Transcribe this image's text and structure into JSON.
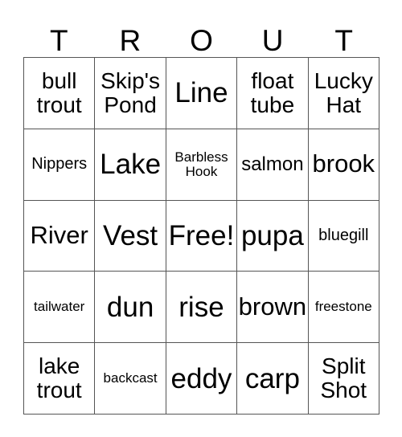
{
  "card": {
    "title_letters": [
      "T",
      "R",
      "O",
      "U",
      "T"
    ],
    "columns": 5,
    "rows": 5,
    "free_space_label": "Free!",
    "free_space_position": {
      "row": 3,
      "column": 3
    },
    "border_color": "#555555",
    "text_color": "#000000",
    "background_color": "#ffffff",
    "grid": [
      [
        {
          "text": "bull\ntrout",
          "size": "lg"
        },
        {
          "text": "Skip's\nPond",
          "size": "lg"
        },
        {
          "text": "Line",
          "size": "xxl"
        },
        {
          "text": "float\ntube",
          "size": "lg"
        },
        {
          "text": "Lucky\nHat",
          "size": "lg"
        }
      ],
      [
        {
          "text": "Nippers",
          "size": "sm"
        },
        {
          "text": "Lake",
          "size": "xxl"
        },
        {
          "text": "Barbless\nHook",
          "size": "xs"
        },
        {
          "text": "salmon",
          "size": "md"
        },
        {
          "text": "brook",
          "size": "xl"
        }
      ],
      [
        {
          "text": "River",
          "size": "xl"
        },
        {
          "text": "Vest",
          "size": "xxl"
        },
        {
          "text": "Free!",
          "size": "xxl"
        },
        {
          "text": "pupa",
          "size": "xxl"
        },
        {
          "text": "bluegill",
          "size": "sm"
        }
      ],
      [
        {
          "text": "tailwater",
          "size": "xs"
        },
        {
          "text": "dun",
          "size": "xxl"
        },
        {
          "text": "rise",
          "size": "xxl"
        },
        {
          "text": "brown",
          "size": "xl"
        },
        {
          "text": "freestone",
          "size": "xs"
        }
      ],
      [
        {
          "text": "lake\ntrout",
          "size": "lg"
        },
        {
          "text": "backcast",
          "size": "xs"
        },
        {
          "text": "eddy",
          "size": "xxl"
        },
        {
          "text": "carp",
          "size": "xxl"
        },
        {
          "text": "Split\nShot",
          "size": "lg"
        }
      ]
    ]
  }
}
